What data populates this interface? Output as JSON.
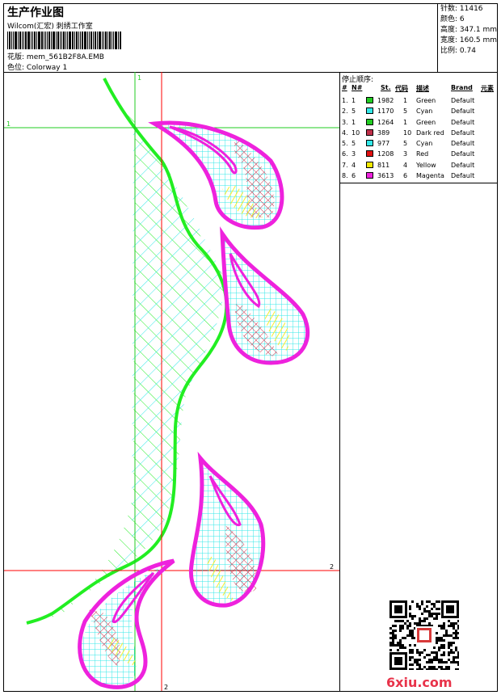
{
  "header": {
    "title": "生产作业图",
    "subtitle": "Wilcom(汇宏) 刺绣工作室",
    "design_label": "花版:",
    "design_value": "mem_561B2F8A.EMB",
    "colorway_label": "色位:",
    "colorway_value": "Colorway 1"
  },
  "info": {
    "stitches": "针数: 11416",
    "colors": "颜色: 6",
    "height": "高度: 347.1 mm",
    "width": "宽度: 160.5 mm",
    "scale": "比例: 0.74"
  },
  "stop_sequence": {
    "title": "停止顺序:",
    "headers": {
      "index": "#",
      "needle": "N#",
      "stitches": "St.",
      "code": "代码",
      "description": "描述",
      "brand": "Brand",
      "element": "元素"
    },
    "rows": [
      {
        "index": "1.",
        "needle": "1",
        "color": "#22cc22",
        "stitches": "1982",
        "code": "1",
        "description": "Green",
        "brand": "Default"
      },
      {
        "index": "2.",
        "needle": "5",
        "color": "#33e8e8",
        "stitches": "1170",
        "code": "5",
        "description": "Cyan",
        "brand": "Default"
      },
      {
        "index": "3.",
        "needle": "1",
        "color": "#22cc22",
        "stitches": "1264",
        "code": "1",
        "description": "Green",
        "brand": "Default"
      },
      {
        "index": "4.",
        "needle": "10",
        "color": "#c0304a",
        "stitches": "389",
        "code": "10",
        "description": "Dark red",
        "brand": "Default"
      },
      {
        "index": "5.",
        "needle": "5",
        "color": "#33e8e8",
        "stitches": "977",
        "code": "5",
        "description": "Cyan",
        "brand": "Default"
      },
      {
        "index": "6.",
        "needle": "3",
        "color": "#e01010",
        "stitches": "1208",
        "code": "3",
        "description": "Red",
        "brand": "Default"
      },
      {
        "index": "7.",
        "needle": "4",
        "color": "#f0e800",
        "stitches": "811",
        "code": "4",
        "description": "Yellow",
        "brand": "Default"
      },
      {
        "index": "8.",
        "needle": "6",
        "color": "#ee22dd",
        "stitches": "3613",
        "code": "6",
        "description": "Magenta",
        "brand": "Default"
      }
    ]
  },
  "guides": {
    "v1_label": "1",
    "h1_label": "1",
    "v2_label": "2",
    "h2_label": "2"
  },
  "colors": {
    "guide_green": "#22cc22",
    "guide_red": "#ff0000",
    "green": "#22ee22",
    "cyan": "#33e8e8",
    "magenta": "#ee22dd",
    "red": "#e01010",
    "yellow": "#f5ee30"
  },
  "watermark": "6xiu.com"
}
